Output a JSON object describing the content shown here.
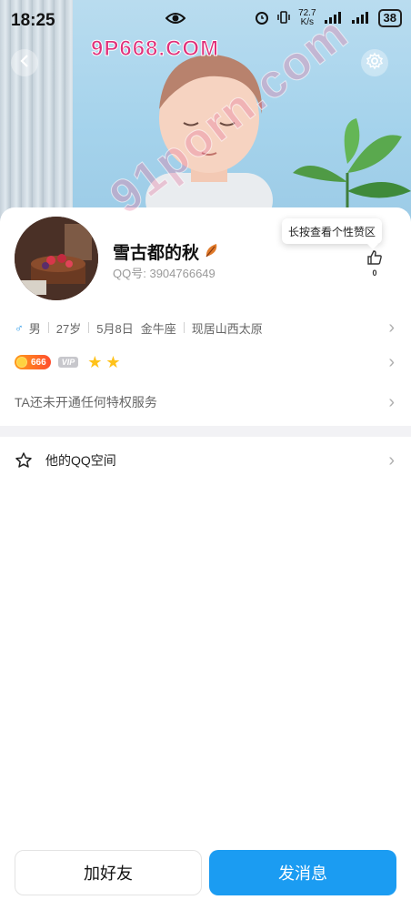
{
  "status_bar": {
    "time": "18:25",
    "net_speed_value": "72.7",
    "net_speed_unit": "K/s",
    "battery": "38"
  },
  "watermarks": {
    "top": "9P668.COM",
    "diagonal": "91porn.com"
  },
  "profile": {
    "nickname": "雪古都的秋",
    "qq_label": "QQ号:",
    "qq_number": "3904766649",
    "like_tip": "长按查看个性赞区",
    "like_count": "0"
  },
  "info": {
    "gender_icon": "♂",
    "gender": "男",
    "age": "27岁",
    "birthday": "5月8日",
    "zodiac": "金牛座",
    "location": "现居山西太原"
  },
  "badges": {
    "level": "666",
    "vip": "VIP",
    "stars": [
      "★",
      "★"
    ],
    "level_color": "#ff6a1a",
    "star_color": "#ffc21a"
  },
  "privilege_text": "TA还未开通任何特权服务",
  "qzone_label": "他的QQ空间",
  "buttons": {
    "add_friend": "加好友",
    "send_message": "发消息",
    "primary_color": "#1b9cf2"
  }
}
